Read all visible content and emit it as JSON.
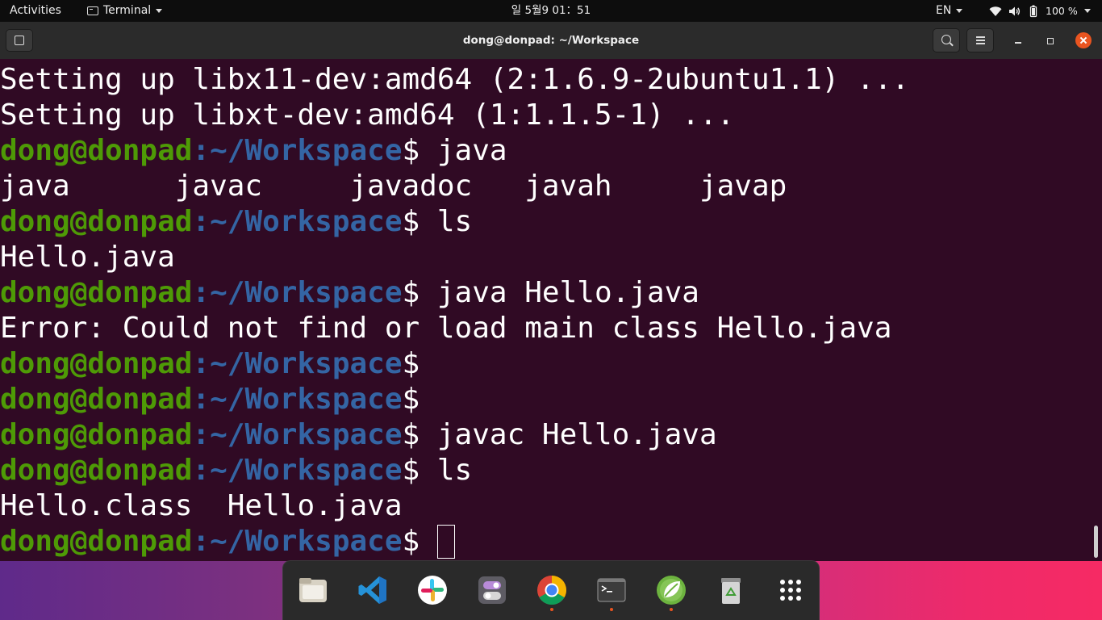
{
  "topbar": {
    "activities": "Activities",
    "app_name": "Terminal",
    "clock": "일 5월9  01：51",
    "language": "EN",
    "battery": "100 %"
  },
  "window": {
    "title": "dong@donpad: ~/Workspace"
  },
  "terminal": {
    "prompt_user": "dong@donpad",
    "prompt_path": ":~/Workspace",
    "prompt_symbol": "$",
    "lines": [
      {
        "type": "output",
        "text": "Setting up libx11-dev:amd64 (2:1.6.9-2ubuntu1.1) ..."
      },
      {
        "type": "output",
        "text": "Setting up libxt-dev:amd64 (1:1.1.5-1) ..."
      },
      {
        "type": "prompt",
        "cmd": " java"
      },
      {
        "type": "output",
        "text": "java      javac     javadoc   javah     javap"
      },
      {
        "type": "prompt",
        "cmd": " ls"
      },
      {
        "type": "output",
        "text": "Hello.java"
      },
      {
        "type": "prompt",
        "cmd": " java Hello.java"
      },
      {
        "type": "output",
        "text": "Error: Could not find or load main class Hello.java"
      },
      {
        "type": "prompt",
        "cmd": ""
      },
      {
        "type": "prompt",
        "cmd": ""
      },
      {
        "type": "prompt",
        "cmd": " javac Hello.java"
      },
      {
        "type": "prompt",
        "cmd": " ls"
      },
      {
        "type": "output",
        "text": "Hello.class  Hello.java"
      },
      {
        "type": "prompt",
        "cmd": " ",
        "cursor": true
      }
    ]
  },
  "dock": {
    "items": [
      {
        "name": "files-icon",
        "running": false
      },
      {
        "name": "vscode-icon",
        "running": false
      },
      {
        "name": "slack-icon",
        "running": false
      },
      {
        "name": "settings-toggle-icon",
        "running": false
      },
      {
        "name": "chrome-icon",
        "running": true
      },
      {
        "name": "terminal-icon",
        "running": true
      },
      {
        "name": "spring-leaf-icon",
        "running": true
      },
      {
        "name": "trash-icon",
        "running": false
      },
      {
        "name": "show-apps-icon",
        "running": false
      }
    ]
  },
  "colors": {
    "terminal_bg": "#300a24",
    "prompt_user": "#4e9a06",
    "prompt_path": "#3465a4",
    "accent": "#e95420"
  }
}
